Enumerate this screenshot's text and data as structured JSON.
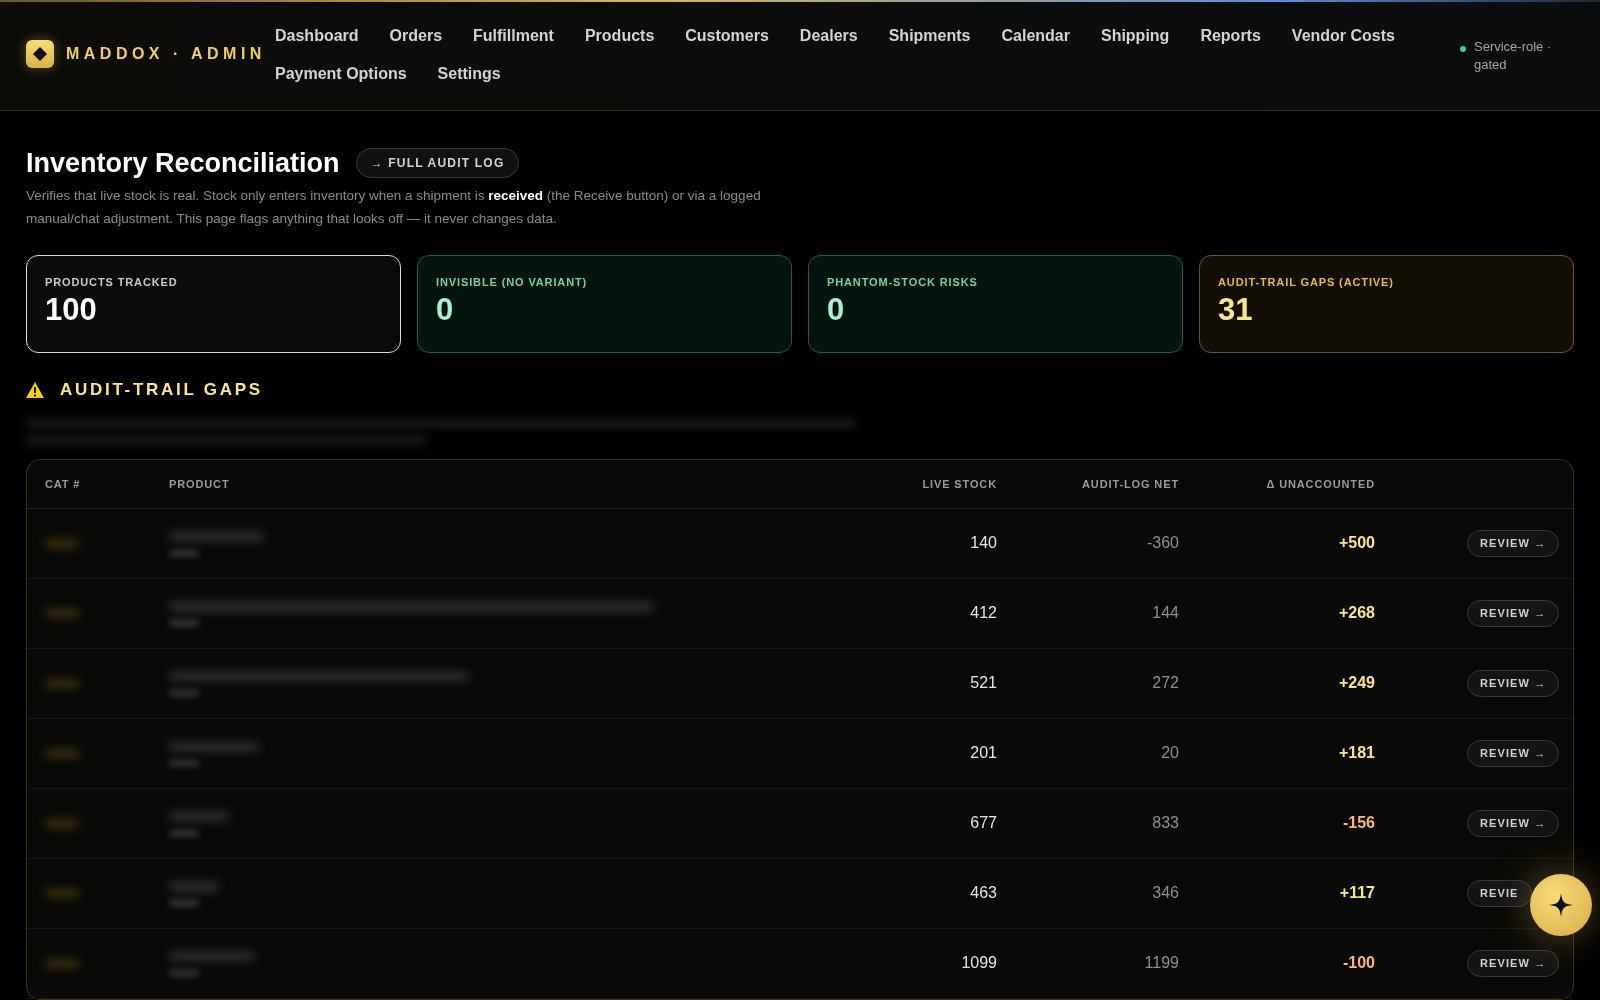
{
  "brand": {
    "name": "MADDOX · ADMIN"
  },
  "nav": [
    "Dashboard",
    "Orders",
    "Fulfillment",
    "Products",
    "Customers",
    "Dealers",
    "Shipments",
    "Calendar",
    "Shipping",
    "Reports",
    "Vendor Costs",
    "Payment Options",
    "Settings"
  ],
  "status": {
    "text": "Service-role · gated"
  },
  "page": {
    "title": "Inventory Reconciliation",
    "link": "→ FULL AUDIT LOG",
    "description": "Verifies that live stock is real. Stock only enters inventory when a shipment is **received** (the Receive button) or via a logged manual/chat adjustment. This page flags anything that looks off — it never changes data."
  },
  "stats": [
    {
      "label": "PRODUCTS TRACKED",
      "value": "100",
      "kind": "neutral"
    },
    {
      "label": "INVISIBLE (NO VARIANT)",
      "value": "0",
      "kind": "ok"
    },
    {
      "label": "PHANTOM-STOCK RISKS",
      "value": "0",
      "kind": "ok"
    },
    {
      "label": "AUDIT-TRAIL GAPS (ACTIVE)",
      "value": "31",
      "kind": "warn"
    }
  ],
  "section": {
    "title": "AUDIT-TRAIL GAPS"
  },
  "table": {
    "columns": [
      "CAT #",
      "PRODUCT",
      "LIVE STOCK",
      "AUDIT-LOG NET",
      "Δ UNACCOUNTED"
    ],
    "rows": [
      {
        "live_stock": "140",
        "audit_log_net": "-360",
        "delta": "+500",
        "kind": "over",
        "action": "REVIEW →"
      },
      {
        "live_stock": "412",
        "audit_log_net": "144",
        "delta": "+268",
        "kind": "over",
        "action": "REVIEW →"
      },
      {
        "live_stock": "521",
        "audit_log_net": "272",
        "delta": "+249",
        "kind": "over",
        "action": "REVIEW →"
      },
      {
        "live_stock": "201",
        "audit_log_net": "20",
        "delta": "+181",
        "kind": "over",
        "action": "REVIEW →"
      },
      {
        "live_stock": "677",
        "audit_log_net": "833",
        "delta": "-156",
        "kind": "under",
        "action": "REVIEW →"
      },
      {
        "live_stock": "463",
        "audit_log_net": "346",
        "delta": "+117",
        "kind": "over",
        "action": "REVIE"
      },
      {
        "live_stock": "1099",
        "audit_log_net": "1199",
        "delta": "-100",
        "kind": "under",
        "action": "REVIEW →"
      }
    ]
  }
}
